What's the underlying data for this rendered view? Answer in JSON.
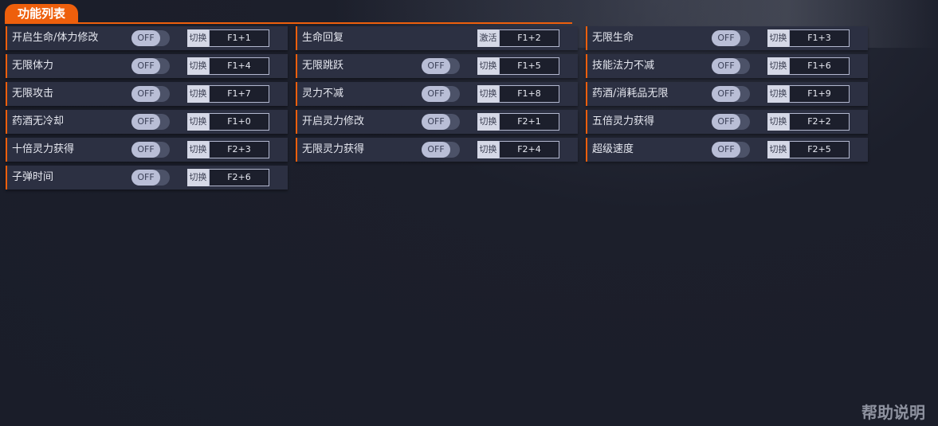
{
  "header": {
    "title": "功能列表"
  },
  "features": [
    {
      "name": "开启生命/体力修改",
      "toggle": "OFF",
      "hotkey_label": "切换",
      "hotkey": "F1+1"
    },
    {
      "name": "生命回复",
      "toggle": null,
      "hotkey_label": "激活",
      "hotkey": "F1+2"
    },
    {
      "name": "无限生命",
      "toggle": "OFF",
      "hotkey_label": "切换",
      "hotkey": "F1+3"
    },
    {
      "name": "无限体力",
      "toggle": "OFF",
      "hotkey_label": "切换",
      "hotkey": "F1+4"
    },
    {
      "name": "无限跳跃",
      "toggle": "OFF",
      "hotkey_label": "切换",
      "hotkey": "F1+5"
    },
    {
      "name": "技能法力不减",
      "toggle": "OFF",
      "hotkey_label": "切换",
      "hotkey": "F1+6"
    },
    {
      "name": "无限攻击",
      "toggle": "OFF",
      "hotkey_label": "切换",
      "hotkey": "F1+7"
    },
    {
      "name": "灵力不减",
      "toggle": "OFF",
      "hotkey_label": "切换",
      "hotkey": "F1+8"
    },
    {
      "name": "药酒/消耗品无限",
      "toggle": "OFF",
      "hotkey_label": "切换",
      "hotkey": "F1+9"
    },
    {
      "name": "药酒无冷却",
      "toggle": "OFF",
      "hotkey_label": "切换",
      "hotkey": "F1+0"
    },
    {
      "name": "开启灵力修改",
      "toggle": "OFF",
      "hotkey_label": "切换",
      "hotkey": "F2+1"
    },
    {
      "name": "五倍灵力获得",
      "toggle": "OFF",
      "hotkey_label": "切换",
      "hotkey": "F2+2"
    },
    {
      "name": "十倍灵力获得",
      "toggle": "OFF",
      "hotkey_label": "切换",
      "hotkey": "F2+3"
    },
    {
      "name": "无限灵力获得",
      "toggle": "OFF",
      "hotkey_label": "切换",
      "hotkey": "F2+4"
    },
    {
      "name": "超级速度",
      "toggle": "OFF",
      "hotkey_label": "切换",
      "hotkey": "F2+5"
    },
    {
      "name": "子弹时间",
      "toggle": "OFF",
      "hotkey_label": "切换",
      "hotkey": "F2+6"
    }
  ],
  "footer": {
    "help_label": "帮助说明"
  },
  "colors": {
    "accent": "#ee5f0c",
    "row_bg": "#2c3042",
    "page_bg": "#1c1f2b"
  }
}
